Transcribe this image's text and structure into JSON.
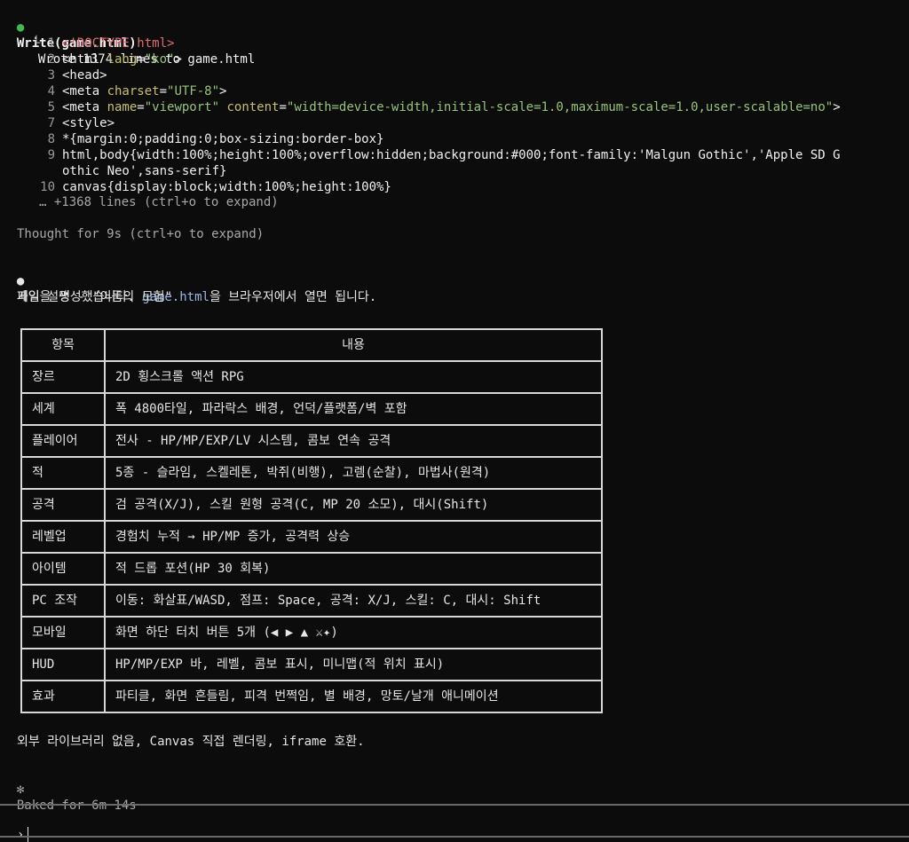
{
  "tool_call": {
    "name": "Write(game.html)",
    "result": "Wrote 1374 lines to game.html"
  },
  "code_lines": [
    {
      "num": "1",
      "parts": [
        [
          "tag",
          "<!DOCTYPE "
        ],
        [
          "tag",
          "html"
        ],
        [
          "tag",
          ">"
        ]
      ]
    },
    {
      "num": "2",
      "parts": [
        [
          "code",
          "<html "
        ],
        [
          "attr",
          "lang"
        ],
        [
          "code",
          "="
        ],
        [
          "str",
          "\"ko\""
        ],
        [
          "code",
          ">"
        ]
      ]
    },
    {
      "num": "3",
      "parts": [
        [
          "code",
          "<head>"
        ]
      ]
    },
    {
      "num": "4",
      "parts": [
        [
          "code",
          "<meta "
        ],
        [
          "attr",
          "charset"
        ],
        [
          "code",
          "="
        ],
        [
          "str",
          "\"UTF-8\""
        ],
        [
          "code",
          ">"
        ]
      ]
    },
    {
      "num": "5",
      "parts": [
        [
          "code",
          "<meta "
        ],
        [
          "attr",
          "name"
        ],
        [
          "code",
          "="
        ],
        [
          "str",
          "\"viewport\""
        ],
        [
          "code",
          " "
        ],
        [
          "attr",
          "content"
        ],
        [
          "code",
          "="
        ],
        [
          "str",
          "\"width=device-width,initial-scale=1.0,maximum-scale=1.0,user-scalable=no\""
        ],
        [
          "code",
          ">"
        ]
      ]
    },
    {
      "num": "7",
      "parts": [
        [
          "code",
          "<style>"
        ]
      ]
    },
    {
      "num": "8",
      "parts": [
        [
          "code",
          "*{margin:0;padding:0;box-sizing:border-box}"
        ]
      ]
    },
    {
      "num": "9",
      "parts": [
        [
          "code",
          "html,body{width:100%;height:100%;overflow:hidden;background:#000;font-family:'Malgun Gothic','Apple SD G"
        ]
      ]
    },
    {
      "num": "",
      "parts": [
        [
          "code",
          "othic Neo',sans-serif}"
        ]
      ]
    },
    {
      "num": "10",
      "parts": [
        [
          "code",
          "canvas{display:block;width:100%;height:100%}"
        ]
      ]
    }
  ],
  "expand_hint": "… +1368 lines (ctrl+o to expand)",
  "thought": "Thought for 9s (ctrl+o to expand)",
  "message": {
    "prefix": "파일을 생성했습니다. ",
    "file": "game.html",
    "suffix": "을 브라우저에서 열면 됩니다."
  },
  "section_title": "게임 설명 - \"어둠의 모험\"",
  "table": {
    "headers": [
      "항목",
      "내용"
    ],
    "rows": [
      [
        "장르",
        "2D 횡스크롤 액션 RPG"
      ],
      [
        "세계",
        "폭 4800타일, 파라락스 배경, 언덕/플랫폼/벽 포함"
      ],
      [
        "플레이어",
        "전사 - HP/MP/EXP/LV 시스템, 콤보 연속 공격"
      ],
      [
        "적",
        "5종 - 슬라임, 스켈레톤, 박쥐(비행), 고렘(순찰), 마법사(원격)"
      ],
      [
        "공격",
        "검 공격(X/J), 스킬 원형 공격(C, MP 20 소모), 대시(Shift)"
      ],
      [
        "레벨업",
        "경험치 누적 → HP/MP 증가, 공격력 상승"
      ],
      [
        "아이템",
        "적 드롭 포션(HP 30 회복)"
      ],
      [
        "PC 조작",
        "이동: 화살표/WASD, 점프: Space, 공격: X/J, 스킬: C, 대시: Shift"
      ],
      [
        "모바일",
        "화면 하단 터치 버튼 5개 (◀ ▶ ▲ ⚔✦)"
      ],
      [
        "HUD",
        "HP/MP/EXP 바, 레벨, 콤보 표시, 미니맵(적 위치 표시)"
      ],
      [
        "효과",
        "파티클, 화면 흔들림, 피격 번쩍임, 별 배경, 망토/날개 애니메이션"
      ]
    ]
  },
  "footer_note": "외부 라이브러리 없음, Canvas 직접 렌더링, iframe 호환.",
  "status": "Baked for 6m 14s",
  "prompt_symbol": "›",
  "colors": {
    "background": "#0c0c0c",
    "bullet_green": "#3fb950",
    "html_tag": "#e06c75",
    "attr": "#c5c06e",
    "string": "#98c379",
    "file_highlight": "#9ab8e8"
  }
}
